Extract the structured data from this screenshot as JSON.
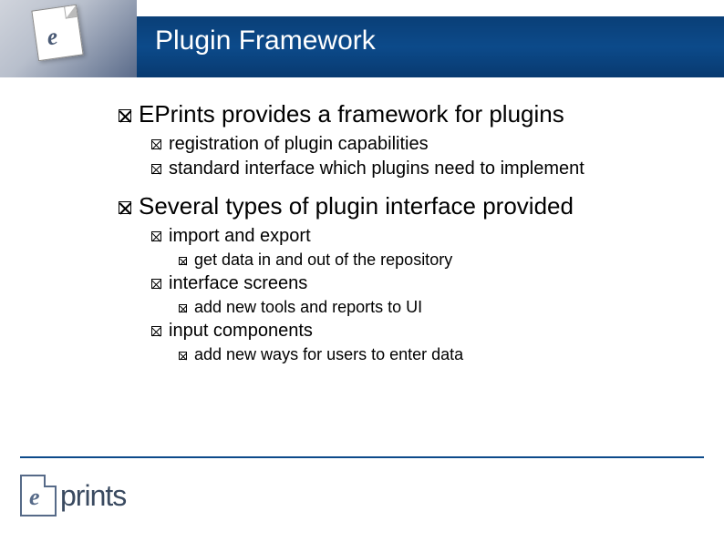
{
  "title": "Plugin Framework",
  "bullets": [
    {
      "level": 1,
      "text": "EPrints provides a framework for plugins"
    },
    {
      "level": 2,
      "text": "registration of plugin capabilities"
    },
    {
      "level": 2,
      "text": "standard interface which plugins need to implement"
    },
    {
      "level": 0,
      "text": ""
    },
    {
      "level": 1,
      "text": "Several types of plugin interface provided"
    },
    {
      "level": 2,
      "text": "import and export"
    },
    {
      "level": 3,
      "text": "get data in and out of the repository"
    },
    {
      "level": 2,
      "text": "interface screens"
    },
    {
      "level": 3,
      "text": "add new tools and reports to UI"
    },
    {
      "level": 2,
      "text": "input components"
    },
    {
      "level": 3,
      "text": "add new ways for users to enter data"
    }
  ],
  "logo_text": "prints"
}
